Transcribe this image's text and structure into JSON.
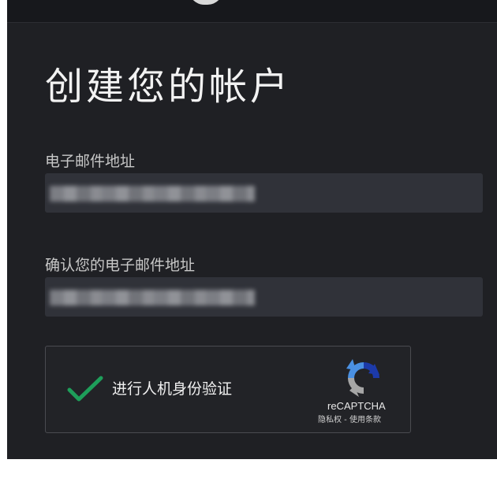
{
  "header": {
    "logo_icon": "circle-logo-icon"
  },
  "form": {
    "title": "创建您的帐户",
    "email": {
      "label": "电子邮件地址",
      "value": ""
    },
    "confirm_email": {
      "label": "确认您的电子邮件地址",
      "value": ""
    }
  },
  "captcha": {
    "label": "进行人机身份验证",
    "checked": true,
    "check_icon": "checkmark-icon",
    "logo_icon": "recaptcha-logo-icon",
    "brand": "reCAPTCHA",
    "privacy_label": "隐私权",
    "separator": " - ",
    "terms_label": "使用条款"
  },
  "colors": {
    "background": "#1f2024",
    "input_background": "#303239",
    "check_green": "#1e9e5a",
    "recaptcha_blue": "#4a90e2",
    "recaptcha_dark_blue": "#1c3aa9",
    "recaptcha_gray": "#a6a6a6"
  }
}
